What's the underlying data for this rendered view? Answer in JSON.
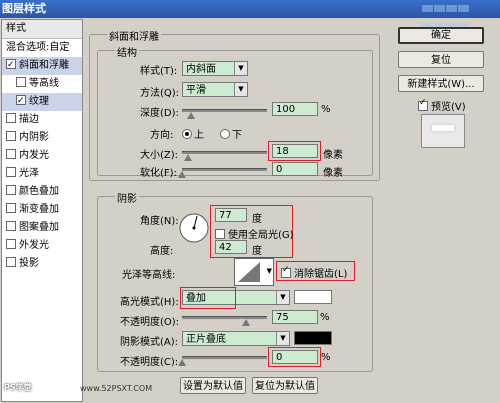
{
  "window": {
    "title": "图层样式"
  },
  "sidebar": {
    "header": "样式",
    "items": [
      {
        "label": "混合选项:自定",
        "checkbox": false,
        "checked": false,
        "selected": false,
        "sub": false
      },
      {
        "label": "斜面和浮雕",
        "checkbox": true,
        "checked": true,
        "selected": true,
        "sub": false
      },
      {
        "label": "等高线",
        "checkbox": true,
        "checked": false,
        "selected": false,
        "sub": true
      },
      {
        "label": "纹理",
        "checkbox": true,
        "checked": true,
        "selected": true,
        "sub": true
      },
      {
        "label": "描边",
        "checkbox": true,
        "checked": false,
        "selected": false,
        "sub": false
      },
      {
        "label": "内阴影",
        "checkbox": true,
        "checked": false,
        "selected": false,
        "sub": false
      },
      {
        "label": "内发光",
        "checkbox": true,
        "checked": false,
        "selected": false,
        "sub": false
      },
      {
        "label": "光泽",
        "checkbox": true,
        "checked": false,
        "selected": false,
        "sub": false
      },
      {
        "label": "颜色叠加",
        "checkbox": true,
        "checked": false,
        "selected": false,
        "sub": false
      },
      {
        "label": "渐变叠加",
        "checkbox": true,
        "checked": false,
        "selected": false,
        "sub": false
      },
      {
        "label": "图案叠加",
        "checkbox": true,
        "checked": false,
        "selected": false,
        "sub": false
      },
      {
        "label": "外发光",
        "checkbox": true,
        "checked": false,
        "selected": false,
        "sub": false
      },
      {
        "label": "投影",
        "checkbox": true,
        "checked": false,
        "selected": false,
        "sub": false
      }
    ]
  },
  "bevel": {
    "group_title": "斜面和浮雕",
    "structure_title": "结构",
    "style_label": "样式(T):",
    "style_value": "内斜面",
    "method_label": "方法(Q):",
    "method_value": "平滑",
    "depth_label": "深度(D):",
    "depth_value": "100",
    "depth_unit": "%",
    "depth_level": 0.1,
    "direction_label": "方向:",
    "direction_up": "上",
    "direction_down": "下",
    "size_label": "大小(Z):",
    "size_value": "18",
    "size_unit": "像素",
    "size_level": 0.07,
    "soften_label": "软化(F):",
    "soften_value": "0",
    "soften_unit": "像素",
    "soften_level": 0.0
  },
  "shading": {
    "title": "阴影",
    "angle_label": "角度(N):",
    "angle_value": "77",
    "angle_unit": "度",
    "global_light_label": "使用全局光(G)",
    "altitude_label": "高度:",
    "altitude_value": "42",
    "altitude_unit": "度",
    "gloss_label": "光泽等高线:",
    "antialias_label": "消除锯齿(L)",
    "highlight_mode_label": "高光模式(H):",
    "highlight_mode_value": "叠加",
    "highlight_color": "#ffffff",
    "highlight_opacity_label": "不透明度(O):",
    "highlight_opacity_value": "75",
    "highlight_opacity_unit": "%",
    "highlight_opacity_level": 0.75,
    "shadow_mode_label": "阴影模式(A):",
    "shadow_mode_value": "正片叠底",
    "shadow_color": "#000000",
    "shadow_opacity_label": "不透明度(C):",
    "shadow_opacity_value": "0",
    "shadow_opacity_unit": "%",
    "shadow_opacity_level": 0.0
  },
  "buttons": {
    "ok": "确定",
    "reset": "复位",
    "new_style": "新建样式(W)...",
    "preview": "预览(V)",
    "set_default": "设置为默认值",
    "reset_default": "复位为默认值"
  },
  "watermark": {
    "left": "PS学堂",
    "right": "www.52PSXT.COM"
  },
  "colors": {
    "field_green": "#cdebd0",
    "highlight_red": "#d9202a",
    "accent": "#2a56a8"
  }
}
